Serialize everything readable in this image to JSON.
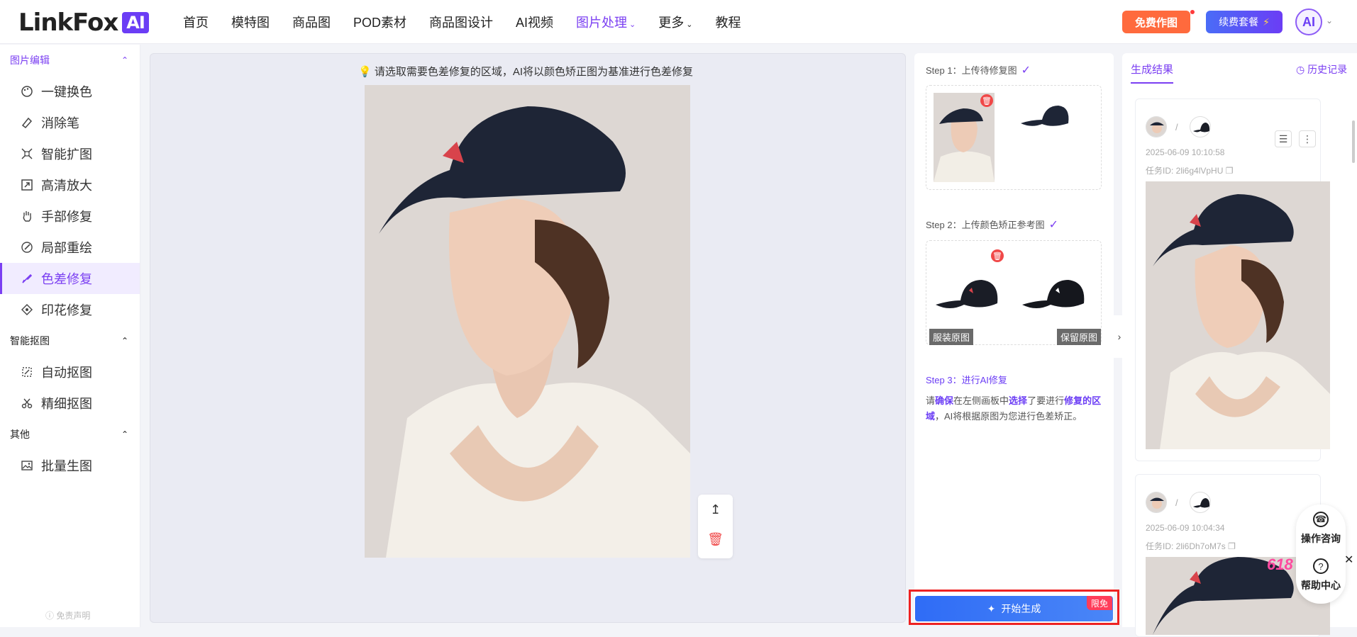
{
  "brand": {
    "name": "LinkFox",
    "badge": "AI"
  },
  "nav": [
    {
      "label": "首页"
    },
    {
      "label": "模特图"
    },
    {
      "label": "商品图"
    },
    {
      "label": "POD素材"
    },
    {
      "label": "商品图设计"
    },
    {
      "label": "AI视频"
    },
    {
      "label": "图片处理",
      "active": true,
      "has_dropdown": true
    },
    {
      "label": "更多",
      "has_dropdown": true
    },
    {
      "label": "教程"
    }
  ],
  "header": {
    "free_btn": "免费作图",
    "renew_btn": "续费套餐",
    "renew_icon": "lightning-icon",
    "avatar": "AI"
  },
  "sidebar": {
    "sections": [
      {
        "title": "图片编辑",
        "items": [
          {
            "label": "一键换色",
            "icon": "palette-icon"
          },
          {
            "label": "消除笔",
            "icon": "eraser-icon"
          },
          {
            "label": "智能扩图",
            "icon": "expand-icon"
          },
          {
            "label": "高清放大",
            "icon": "upscale-icon"
          },
          {
            "label": "手部修复",
            "icon": "hand-icon"
          },
          {
            "label": "局部重绘",
            "icon": "brush-icon"
          },
          {
            "label": "色差修复",
            "icon": "color-fix-icon",
            "active": true
          },
          {
            "label": "印花修复",
            "icon": "print-icon"
          }
        ]
      },
      {
        "title": "智能抠图",
        "items": [
          {
            "label": "自动抠图",
            "icon": "auto-cutout-icon"
          },
          {
            "label": "精细抠图",
            "icon": "fine-cutout-icon"
          }
        ]
      },
      {
        "title": "其他",
        "items": [
          {
            "label": "批量生图",
            "icon": "image-icon"
          }
        ]
      }
    ],
    "disclaimer": "免责声明"
  },
  "canvas": {
    "tip": "请选取需要色差修复的区域，AI将以颜色矫正图为基准进行色差修复",
    "tip_icon": "bulb-icon"
  },
  "steps": {
    "step1": "Step 1：上传待修复图",
    "step2": "Step 2：上传颜色矫正参考图",
    "label_original": "服装原图",
    "label_keep": "保留原图",
    "step3": "Step 3：进行AI修复",
    "step3_text": {
      "p1": "请",
      "b1": "确保",
      "p2": "在左侧画板中",
      "b2": "选择",
      "p3": "了要进行",
      "b3": "修复的区域",
      "p4": "，AI将根据原图为您进行色差矫正。"
    },
    "generate": "开始生成",
    "generate_badge": "限免"
  },
  "results": {
    "tab": "生成结果",
    "history": "历史记录",
    "cards": [
      {
        "date": "2025-06-09 10:10:58",
        "task": "任务ID: 2li6g4lVpHU"
      },
      {
        "date": "2025-06-09 10:04:34",
        "task": "任务ID: 2li6Dh7oM7s"
      }
    ]
  },
  "help": {
    "consult": "操作咨询",
    "center": "帮助中心"
  },
  "promo": "618"
}
